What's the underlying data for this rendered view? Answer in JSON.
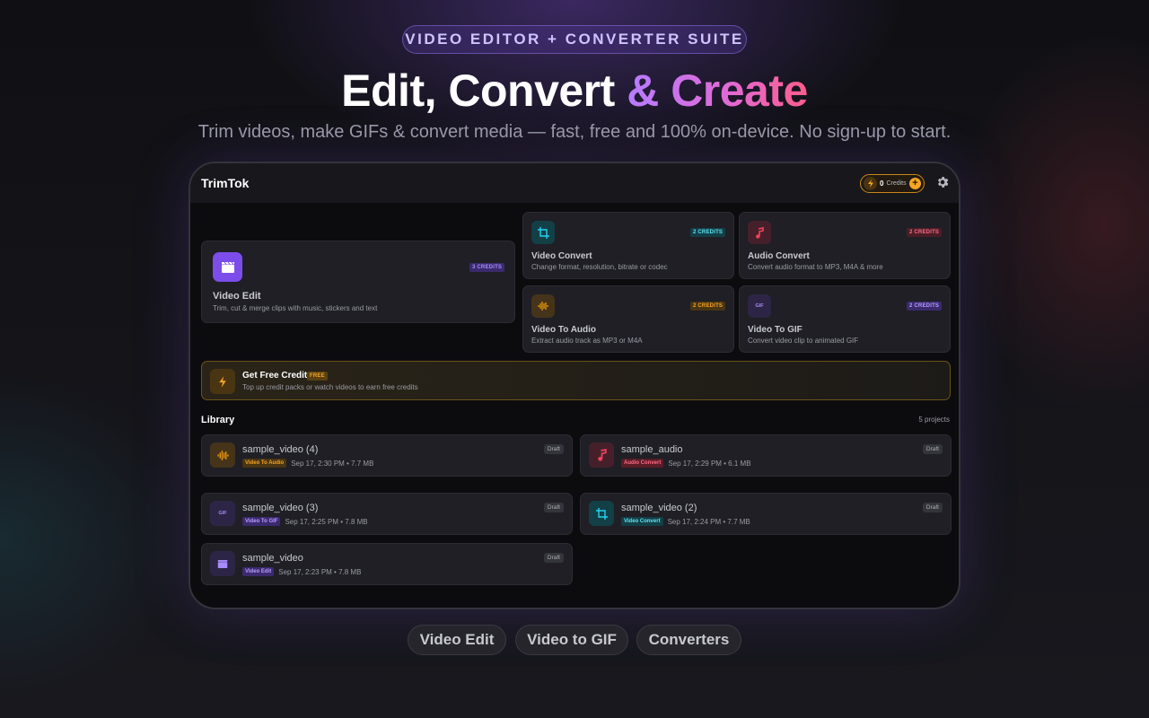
{
  "hero": {
    "badge": "VIDEO EDITOR + CONVERTER SUITE",
    "title_main": "Edit, Convert ",
    "title_accent": "& Create",
    "subtitle": "Trim videos, make GIFs & convert media — fast, free and 100% on-device. No sign-up to start."
  },
  "app": {
    "brand": "TrimTok",
    "credits": {
      "count": "0",
      "label": "Credits",
      "add_icon": "plus-icon"
    },
    "settings_icon": "gear-icon"
  },
  "tools": {
    "video_edit": {
      "title": "Video Edit",
      "desc": "Trim, cut & merge clips with music, stickers and text",
      "badge": "3 CREDITS",
      "icon": "clapperboard-icon",
      "color": "#8b5cf6"
    },
    "video_convert": {
      "title": "Video Convert",
      "desc": "Change format, resolution, bitrate or codec",
      "badge": "2 CREDITS",
      "icon": "crop-icon",
      "color": "#22d3ee"
    },
    "audio_convert": {
      "title": "Audio Convert",
      "desc": "Convert audio format to MP3, M4A & more",
      "badge": "2 CREDITS",
      "icon": "music-note-icon",
      "color": "#f43f5e"
    },
    "video_to_audio": {
      "title": "Video To Audio",
      "desc": "Extract audio track as MP3 or M4A",
      "badge": "2 CREDITS",
      "icon": "waveform-icon",
      "color": "#f59e0b"
    },
    "video_to_gif": {
      "title": "Video To GIF",
      "desc": "Convert video clip to animated GIF",
      "badge": "2 CREDITS",
      "icon": "gif-icon",
      "icon_text": "GIF",
      "color": "#a78bfa"
    }
  },
  "free_credits": {
    "title": "Get Free Credits",
    "badge": "FREE",
    "desc": "Top up credit packs or watch videos to earn free credits",
    "icon": "lightning-icon"
  },
  "library": {
    "title": "Library",
    "count": "5 projects",
    "items": [
      {
        "name": "sample_video (4)",
        "tag": "Video To Audio",
        "meta": "Sep 17, 2:30 PM • 7.7 MB",
        "status": "Draft",
        "icon": "waveform-icon"
      },
      {
        "name": "sample_audio",
        "tag": "Audio Convert",
        "meta": "Sep 17, 2:29 PM • 6.1 MB",
        "status": "Draft",
        "icon": "music-note-icon"
      },
      {
        "name": "sample_video (3)",
        "tag": "Video To GIF",
        "meta": "Sep 17, 2:25 PM • 7.8 MB",
        "status": "Draft",
        "icon": "gif-icon",
        "icon_text": "GIF"
      },
      {
        "name": "sample_video (2)",
        "tag": "Video Convert",
        "meta": "Sep 17, 2:24 PM • 7.7 MB",
        "status": "Draft",
        "icon": "crop-icon"
      },
      {
        "name": "sample_video",
        "tag": "Video Edit",
        "meta": "Sep 17, 2:23 PM • 7.8 MB",
        "status": "Draft",
        "icon": "clapperboard-icon"
      }
    ]
  },
  "bottom_nav": [
    "Video Edit",
    "Video to GIF",
    "Converters"
  ]
}
